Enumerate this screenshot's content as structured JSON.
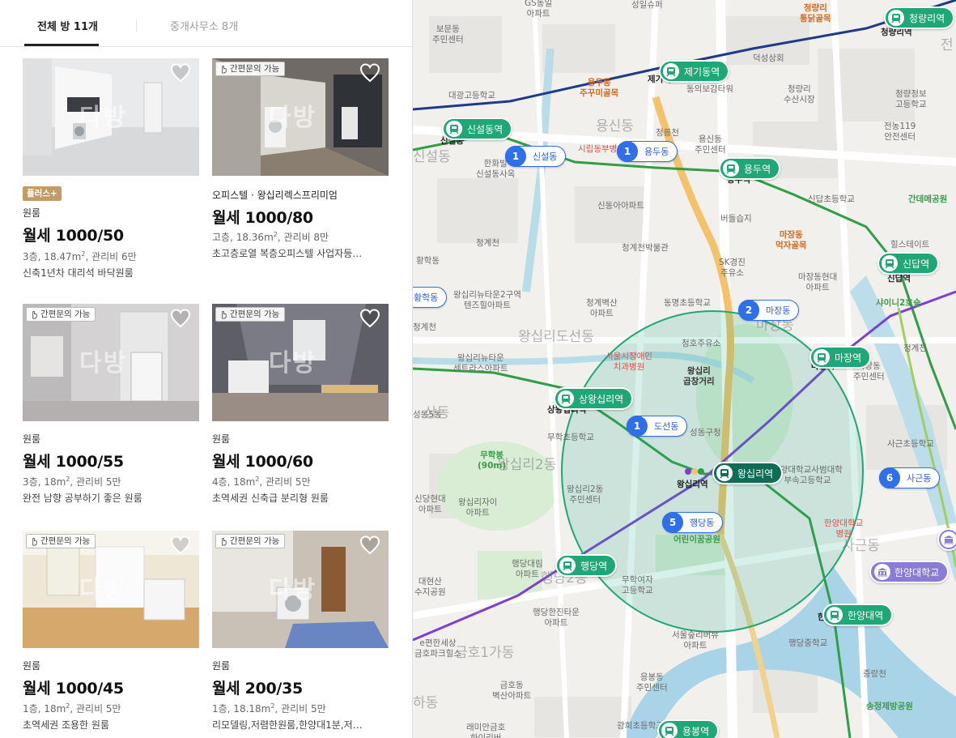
{
  "tabs": {
    "rooms": "전체 방 11개",
    "agencies": "중개사무소 8개"
  },
  "contact_badge": "간편문의 가능",
  "watermark": "다방",
  "listings": [
    {
      "plus": "플러스+",
      "type": "원룸",
      "price": "월세 1000/50",
      "spec_a": "3층, 18.47m",
      "spec_b": ", 관리비 6만",
      "desc": "신축1년차 대리석 바닥원룸"
    },
    {
      "badge": true,
      "type": "오피스텔 · 왕십리렉스프리미엄",
      "price": "월세 1000/80",
      "spec_a": "고층, 18.36m",
      "spec_b": ", 관리비 8만",
      "desc": "초고층로열 복층오피스텔 사업자등…"
    },
    {
      "badge": true,
      "type": "원룸",
      "price": "월세 1000/55",
      "spec_a": "3층, 18m",
      "spec_b": ", 관리비 5만",
      "desc": "완전 남향 공부하기 좋은 원룸"
    },
    {
      "badge": true,
      "type": "원룸",
      "price": "월세 1000/60",
      "spec_a": "4층, 18m",
      "spec_b": ", 관리비 5만",
      "desc": "초역세권 신축급 분리형 원룸"
    },
    {
      "badge": true,
      "type": "원룸",
      "price": "월세 1000/45",
      "spec_a": "1층, 18m",
      "spec_b": ", 관리비 5만",
      "desc": "초역세권 조용한 원룸"
    },
    {
      "badge": true,
      "type": "원룸",
      "price": "월세 200/35",
      "spec_a": "1층, 18.18m",
      "spec_b": ", 관리비 5만",
      "desc": "리모델링,저렴한원룸,한양대1분,저…"
    }
  ],
  "map": {
    "stations": [
      {
        "label": "청량리역"
      },
      {
        "label": "제기동역"
      },
      {
        "label": "신설동역"
      },
      {
        "label": "용두역"
      },
      {
        "label": "신답역"
      },
      {
        "label": "상왕십리역"
      },
      {
        "label": "마장역"
      },
      {
        "label": "왕십리역"
      },
      {
        "label": "행당역"
      },
      {
        "label": "한양대역"
      },
      {
        "label": "용봉역"
      }
    ],
    "clusters": [
      {
        "num": "1",
        "label": "신설동"
      },
      {
        "num": "1",
        "label": "용두동"
      },
      {
        "num": "2",
        "label": "마장동"
      },
      {
        "num": "1",
        "label": "도선동"
      },
      {
        "num": "6",
        "label": "사근동"
      },
      {
        "num": "5",
        "label": "행당동"
      },
      {
        "label": "황학동"
      }
    ],
    "university": "한양대학교",
    "places": {
      "p1": "GS동일\n아파트",
      "p2": "보문동\n주민센터",
      "p3": "성일슈퍼",
      "p4": "청량리\n통닭골목",
      "p5": "청량리역",
      "p6": "덕성상회",
      "p7": "용두동\n주꾸미골목",
      "p8": "동의보감타워",
      "p9": "청량리\n수산시장",
      "p10": "대광고등학교",
      "p11": "용신동",
      "p12": "정릉천",
      "p13": "시립동부병원",
      "p14": "용신동\n주민센터",
      "p15": "청량정보\n고등학교",
      "p16": "전농119\n안전센터",
      "p17": "한화빌\n신설동사옥",
      "p18": "신설동",
      "p19": "신동아아파트",
      "p20": "신답초등학교",
      "p21": "간데메공원",
      "p22": "버들습지",
      "p23": "마장동\n먹자골목",
      "p24": "청계천",
      "p25": "청계천박물관",
      "p26": "SK경진\n주유소",
      "p27": "힐스테이트",
      "p28": "신답역",
      "p29": "마장동현대\n아파트",
      "p30": "왕십리뉴타운2구역\n텐즈힐아파트",
      "p31": "청계벽산\n아파트",
      "p32": "동명초등학교",
      "p33": "샤이니2호숲",
      "p34": "왕십리도선동",
      "p35": "마장동",
      "p36": "청호주유소",
      "p37": "서울시장애인\n치과병원",
      "p38": "왕십리\n곱창거리",
      "p39": "왕십리뉴타운\n센트라스아파트",
      "p40": "청계천",
      "p41": "마장동\n주민센터",
      "p42": "상왕십리역",
      "p43": "무학초등학교",
      "p44": "성동구청",
      "p45": "사근초등학교",
      "p46": "무학봉\n(90m)",
      "p47": "왕십리2동",
      "p48": "왕십리역",
      "p49": "한양대학교사범대학\n부속고등학교",
      "p50": "신당현대\n아파트",
      "p51": "왕십리자이\n아파트",
      "p52": "왕십리2동\n주민센터",
      "p53": "한양대학교\n병원",
      "p54": "어린이꿈공원",
      "p55": "사근동",
      "p56": "행당대림\n아파트",
      "p57": "행당2동",
      "p58": "대현산\n수지공원",
      "p59": "행당한진타운\n아파트",
      "p60": "무학여자\n고등학교",
      "p61": "서울숲리버뷰\n아파트",
      "p62": "한양대",
      "p63": "행당중학교",
      "p64": "e편한세상\n금호파크힐스",
      "p65": "금호1가동",
      "p66": "중랑천",
      "p67": "금호동\n벽산아파트",
      "p68": "응봉동\n주민센터",
      "p69": "송정제방공원",
      "p70": "래미안금호\n하이리버",
      "p71": "광희초등학교",
      "p72": "하동",
      "p73": "상동",
      "p74": "제기역",
      "p75": "마장역",
      "p76": "용두역",
      "p77": "전",
      "p78": "신설동",
      "p79": "황학동",
      "p80": "성동5동",
      "p81": "청계천"
    }
  }
}
